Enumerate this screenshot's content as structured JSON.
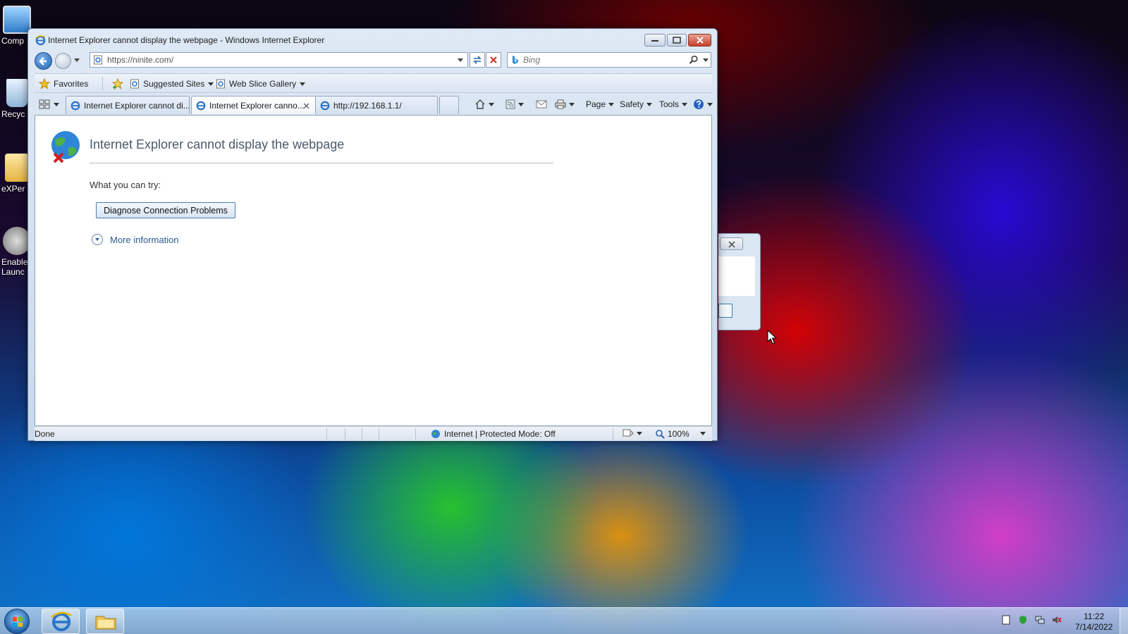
{
  "desktop": {
    "icons": [
      {
        "label": "Comp"
      },
      {
        "label": "Recyc"
      },
      {
        "label": "eXPer"
      },
      {
        "label": "Enable",
        "label2": "Launc"
      }
    ]
  },
  "window": {
    "title": "Internet Explorer cannot display the webpage - Windows Internet Explorer"
  },
  "address_bar": {
    "value": "https://ninite.com/"
  },
  "search": {
    "placeholder": "Bing"
  },
  "favorites_bar": {
    "favorites_label": "Favorites",
    "suggested_sites_label": "Suggested Sites",
    "web_slice_gallery_label": "Web Slice Gallery"
  },
  "tabs": [
    {
      "label": "Internet Explorer cannot di..."
    },
    {
      "label": "Internet Explorer canno...",
      "active": true
    },
    {
      "label": "http://192.168.1.1/"
    }
  ],
  "command_bar": {
    "page_label": "Page",
    "safety_label": "Safety",
    "tools_label": "Tools"
  },
  "content": {
    "heading": "Internet Explorer cannot display the webpage",
    "try_label": "What you can try:",
    "diagnose_button": "Diagnose Connection Problems",
    "more_info": "More information"
  },
  "status_bar": {
    "status": "Done",
    "zone": "Internet | Protected Mode: Off",
    "zoom": "100%"
  },
  "taskbar": {
    "time": "11:22",
    "date": "7/14/2022"
  },
  "colors": {
    "accent": "#2c5b94",
    "close_button": "#c7402d"
  }
}
